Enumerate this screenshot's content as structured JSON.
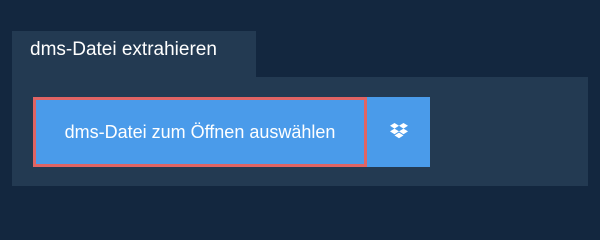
{
  "tab": {
    "label": "dms-Datei extrahieren"
  },
  "actions": {
    "select_file_label": "dms-Datei zum Öffnen auswählen",
    "dropbox_icon": "dropbox-icon"
  },
  "colors": {
    "background": "#13273f",
    "panel": "#233a52",
    "button": "#4a9bea",
    "highlight_border": "#e06464"
  }
}
